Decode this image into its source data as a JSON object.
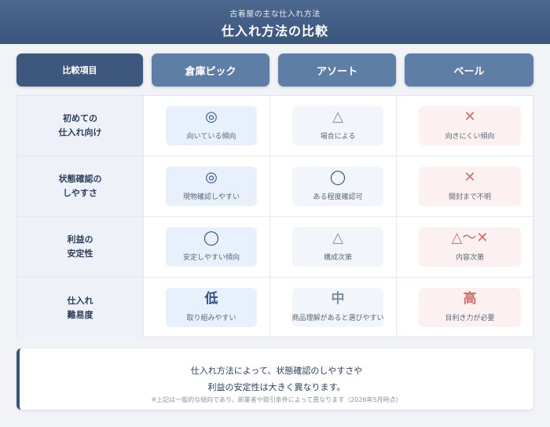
{
  "header": {
    "subtitle": "古着屋の主な仕入れ方法",
    "title": "仕入れ方法の比較"
  },
  "columns": [
    "比較項目",
    "倉庫ピック",
    "アソート",
    "ベール"
  ],
  "rows": [
    {
      "label_lines": [
        "初めての",
        "仕入れ向け"
      ],
      "cells": [
        {
          "mark": "◎",
          "text": "向いている傾向",
          "tone": "blue"
        },
        {
          "mark": "△",
          "text": "場合による",
          "tone": "gray"
        },
        {
          "mark": "✕",
          "text": "向きにくい傾向",
          "tone": "pink"
        }
      ]
    },
    {
      "label_lines": [
        "状態確認の",
        "しやすさ"
      ],
      "cells": [
        {
          "mark": "◎",
          "text": "現物確認しやすい",
          "tone": "blue"
        },
        {
          "mark": "◯",
          "text": "ある程度確認可",
          "tone": "gray"
        },
        {
          "mark": "✕",
          "text": "開封まで不明",
          "tone": "pink"
        }
      ]
    },
    {
      "label_lines": [
        "利益の",
        "安定性"
      ],
      "cells": [
        {
          "mark": "◯",
          "text": "安定しやすい傾向",
          "tone": "blue"
        },
        {
          "mark": "△",
          "text": "構成次第",
          "tone": "gray"
        },
        {
          "mark": "△〜✕",
          "text": "内容次第",
          "tone": "pink"
        }
      ]
    },
    {
      "label_lines": [
        "仕入れ",
        "難易度"
      ],
      "cells": [
        {
          "mark": "低",
          "text": "取り組みやすい",
          "tone": "blue"
        },
        {
          "mark": "中",
          "text": "商品理解があると選びやすい",
          "tone": "gray"
        },
        {
          "mark": "高",
          "text": "目利き力が必要",
          "tone": "pink"
        }
      ]
    }
  ],
  "note": {
    "line1": "仕入れ方法によって、状態確認のしやすさや",
    "line2": "利益の安定性は大きく異なります。",
    "footnote": "※上記は一般的な傾向であり、卸業者や取引条件によって異なります（2026年5月時点）"
  },
  "colors": {
    "header": "#3b557b",
    "column_head": "#5f7ea6",
    "good": "#2e4f80",
    "neutral": "#7f8ea3",
    "bad": "#c97070"
  }
}
